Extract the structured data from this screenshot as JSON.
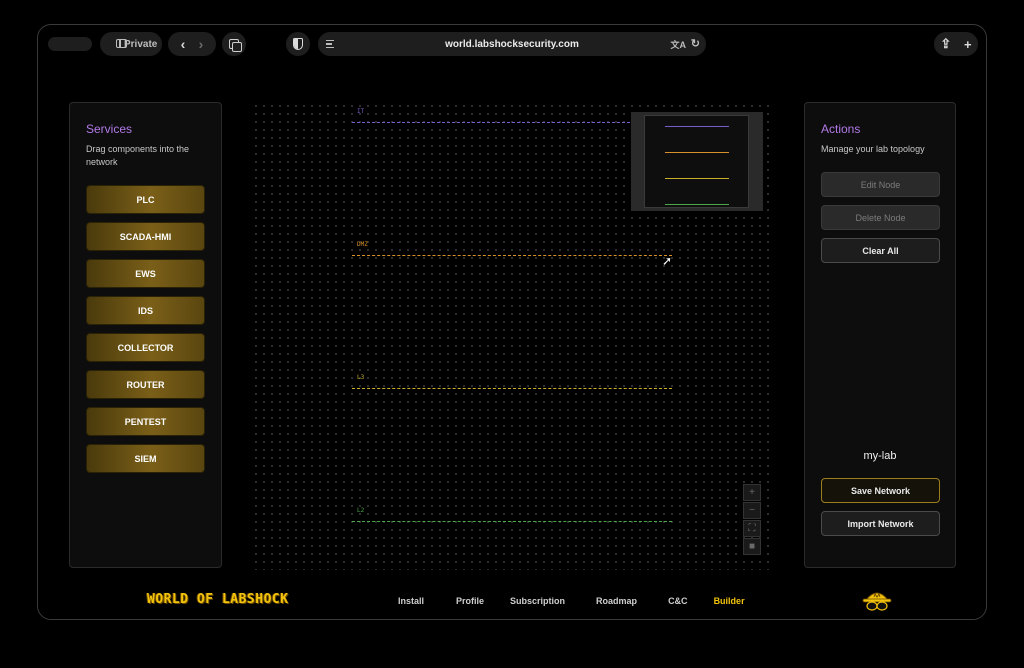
{
  "browser": {
    "private_label": "Private",
    "url": "world.labshocksecurity.com"
  },
  "services": {
    "title": "Services",
    "subtitle": "Drag components into the network",
    "items": [
      "PLC",
      "SCADA-HMI",
      "EWS",
      "IDS",
      "COLLECTOR",
      "ROUTER",
      "PENTEST",
      "SIEM"
    ]
  },
  "canvas": {
    "networks": [
      {
        "label": "IT",
        "color": "#7a5cc8"
      },
      {
        "label": "DMZ",
        "color": "#d8902a"
      },
      {
        "label": "L3",
        "color": "#c8b02a"
      },
      {
        "label": "L2",
        "color": "#4aa84a"
      }
    ],
    "zoom_controls": [
      "+",
      "−",
      "⛶",
      "■"
    ]
  },
  "actions": {
    "title": "Actions",
    "subtitle": "Manage your lab topology",
    "edit_node": "Edit Node",
    "delete_node": "Delete Node",
    "clear_all": "Clear All",
    "lab_name": "my-lab",
    "save_network": "Save Network",
    "import_network": "Import Network"
  },
  "footer": {
    "brand": "WORLD OF LABSHOCK",
    "nav": [
      "Install",
      "Profile",
      "Subscription",
      "Roadmap",
      "C&C",
      "Builder"
    ],
    "active_nav": "Builder"
  },
  "colors": {
    "accent_purple": "#b27ae8",
    "accent_gold": "#f2c30c",
    "service_gold": "#7a5f18"
  }
}
